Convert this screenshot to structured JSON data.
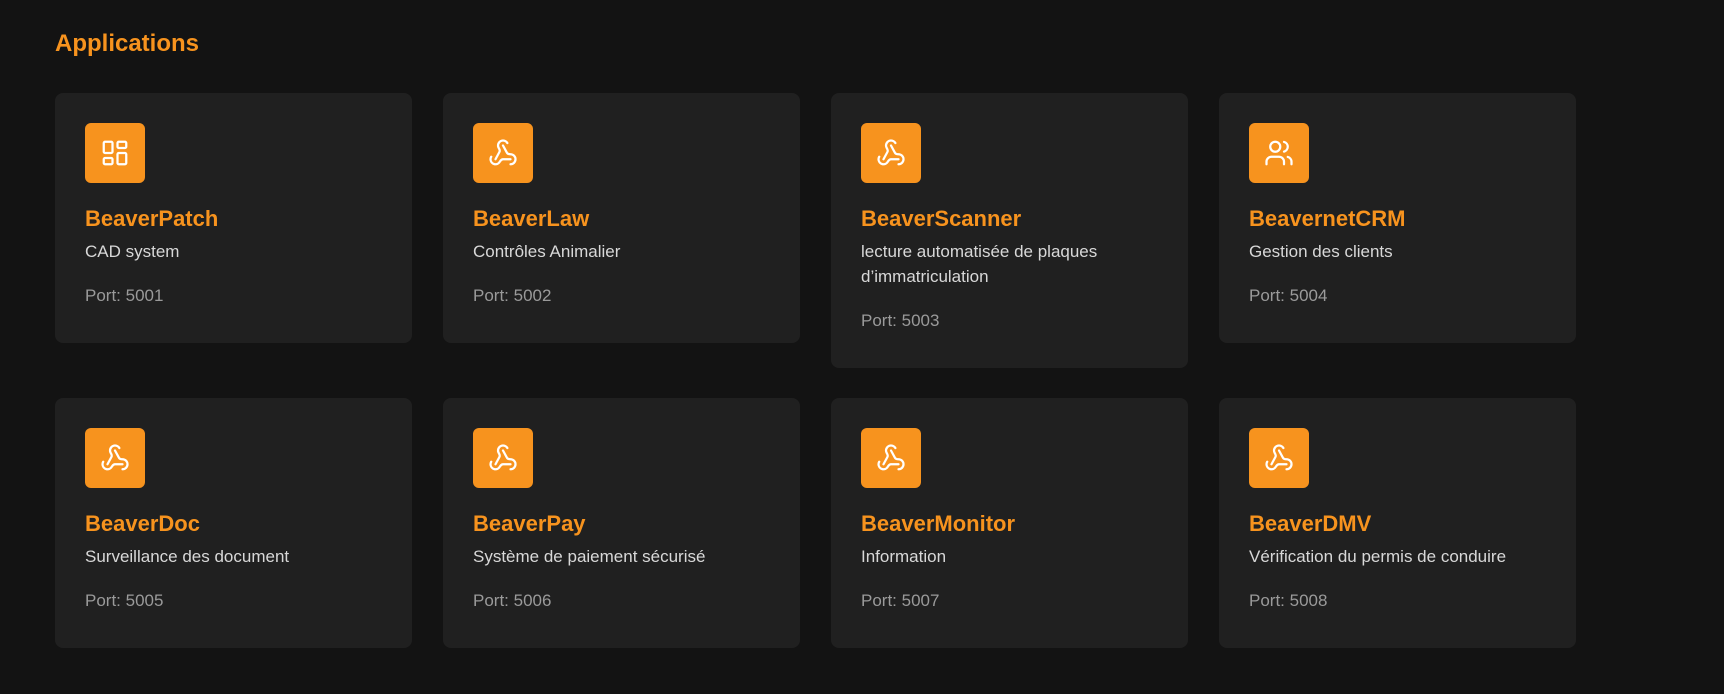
{
  "page": {
    "section_title": "Applications"
  },
  "colors": {
    "accent": "#f7931e",
    "card_bg": "#202020",
    "page_bg": "#131313"
  },
  "apps": [
    {
      "name": "BeaverPatch",
      "description": "CAD system",
      "port": "Port: 5001",
      "icon": "dashboard-icon"
    },
    {
      "name": "BeaverLaw",
      "description": "Contrôles Animalier",
      "port": "Port: 5002",
      "icon": "webhook-icon"
    },
    {
      "name": "BeaverScanner",
      "description": "lecture automatisée de plaques d’immatriculation",
      "port": "Port: 5003",
      "icon": "webhook-icon"
    },
    {
      "name": "BeavernetCRM",
      "description": "Gestion des clients",
      "port": "Port: 5004",
      "icon": "users-icon"
    },
    {
      "name": "BeaverDoc",
      "description": "Surveillance des document",
      "port": "Port: 5005",
      "icon": "webhook-icon"
    },
    {
      "name": "BeaverPay",
      "description": "Système de paiement sécurisé",
      "port": "Port: 5006",
      "icon": "webhook-icon"
    },
    {
      "name": "BeaverMonitor",
      "description": "Information",
      "port": "Port: 5007",
      "icon": "webhook-icon"
    },
    {
      "name": "BeaverDMV",
      "description": "Vérification du permis de conduire",
      "port": "Port: 5008",
      "icon": "webhook-icon"
    }
  ]
}
